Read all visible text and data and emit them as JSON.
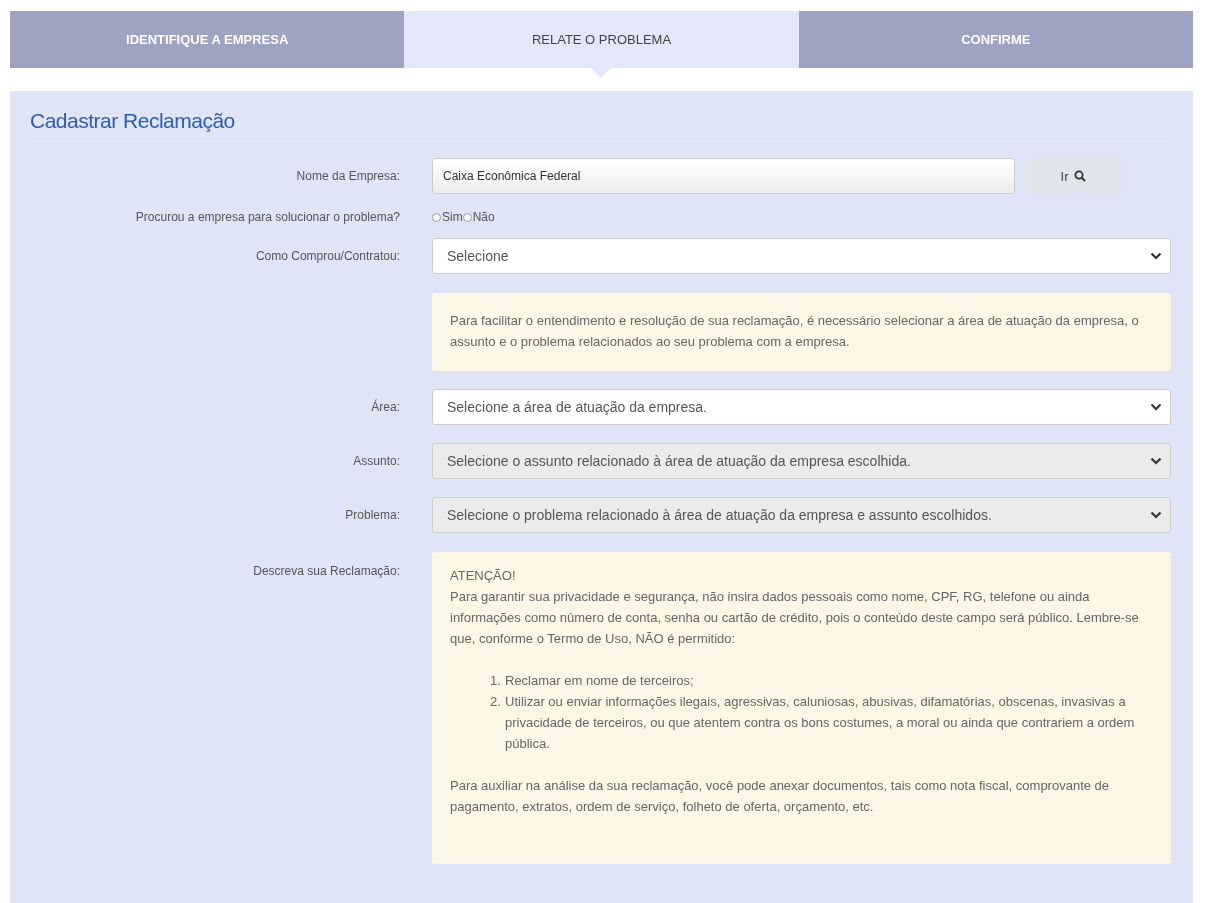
{
  "steps": [
    {
      "label": "IDENTIFIQUE A EMPRESA",
      "selected": false
    },
    {
      "label": "RELATE O PROBLEMA",
      "selected": true
    },
    {
      "label": "CONFIRME",
      "selected": false
    }
  ],
  "title": "Cadastrar Reclamação",
  "company": {
    "label": "Nome da Empresa:",
    "value": "Caixa Econômica Federal",
    "button": "Ir"
  },
  "contacted": {
    "label": "Procurou a empresa para solucionar o problema?",
    "options": [
      {
        "label": "Sim",
        "selected": false
      },
      {
        "label": "Não",
        "selected": false
      }
    ]
  },
  "purchase": {
    "label": "Como Comprou/Contratou:",
    "value": "Selecione",
    "disabled": false
  },
  "info": "Para facilitar o entendimento e resolução de sua reclamação, é necessário selecionar a área de atuação da empresa, o assunto e o problema relacionados ao seu problema com a empresa.",
  "selects": [
    {
      "label": "Área:",
      "value": "Selecione a área de atuação da empresa.",
      "disabled": false
    },
    {
      "label": "Assunto:",
      "value": "Selecione o assunto relacionado à área de atuação da empresa escolhida.",
      "disabled": true
    },
    {
      "label": "Problema:",
      "value": "Selecione o problema relacionado à área de atuação da empresa e assunto escolhidos.",
      "disabled": true
    }
  ],
  "description": {
    "label": "Descreva sua Reclamação:",
    "heading": "ATENÇÃO!",
    "intro": "Para garantir sua privacidade e segurança, não insira dados pessoais como nome, CPF, RG, telefone ou ainda informações como número de conta, senha ou cartão de crédito, pois o conteúdo deste campo será público. Lembre-se que, conforme o Termo de Uso, NÃO é permitido:",
    "rules": [
      {
        "number": "1.",
        "text": "Reclamar em nome de terceiros;"
      },
      {
        "number": "2.",
        "text": "Utilizar ou enviar informações ilegais, agressivas, caluniosas, abusivas, difamatórias, obscenas, invasivas a privacidade de terceiros, ou que atentem contra os bons costumes, a moral ou ainda que contrariem a ordem pública."
      }
    ],
    "footer": "Para auxiliar na análise da sua reclamação, você pode anexar documentos, tais como nota fiscal, comprovante de pagamento, extratos, ordem de serviço, folheto de oferta, orçamento, etc."
  }
}
